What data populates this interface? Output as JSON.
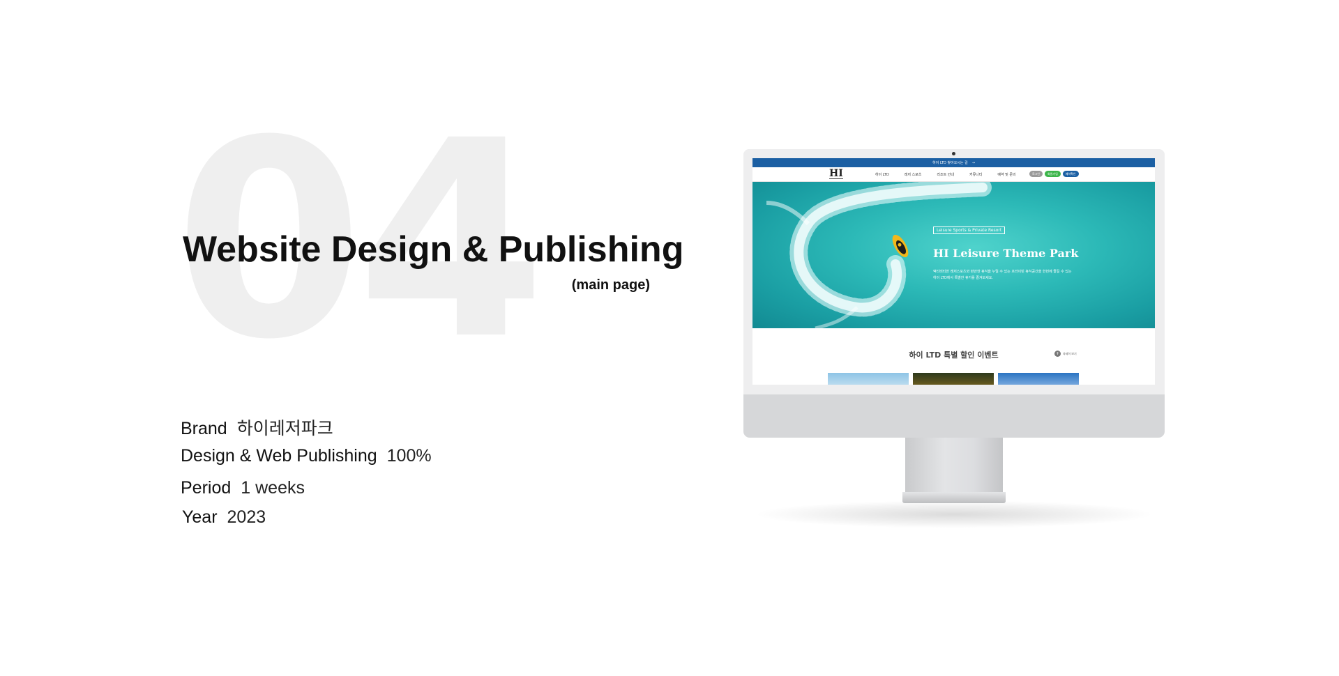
{
  "hero_number": "04",
  "title": "Website Design & Publishing",
  "subtitle": "(main page)",
  "info": {
    "brand": {
      "label": "Brand",
      "value": "하이레저파크"
    },
    "design": {
      "label": "Design & Web Publishing",
      "value": "100%"
    },
    "period": {
      "label": "Period",
      "value": "1 weeks"
    },
    "year": {
      "label": "Year",
      "value": "2023"
    }
  },
  "site": {
    "topbar_text": "하이 LTD 찾아오시는 길",
    "topbar_arrow": "→",
    "logo": "HI",
    "nav": [
      "하이 LTD",
      "레저 스포츠",
      "리조트 안내",
      "커뮤니티",
      "예약 및 문의"
    ],
    "auth": {
      "login": "로그인",
      "join": "회원가입",
      "reserve": "예약확인"
    },
    "hero": {
      "tag": "Leisure Sports & Private Resort",
      "title": "HI Leisure Theme Park",
      "desc": "액티비티한 레저스포츠와 편안한 휴식을 누릴 수 있는 프라이빗 휴식공간을 한번에 즐길 수 있는 하이 LTD에서 특별한 휴가를 즐겨보세요."
    },
    "event": {
      "title": "하이 LTD 특별 할인 이벤트",
      "more": "자세히 보기",
      "more_icon": "+"
    }
  },
  "colors": {
    "brand_blue": "#1b5fa3",
    "green": "#3bb54a",
    "sea": "#2cb9b7"
  }
}
